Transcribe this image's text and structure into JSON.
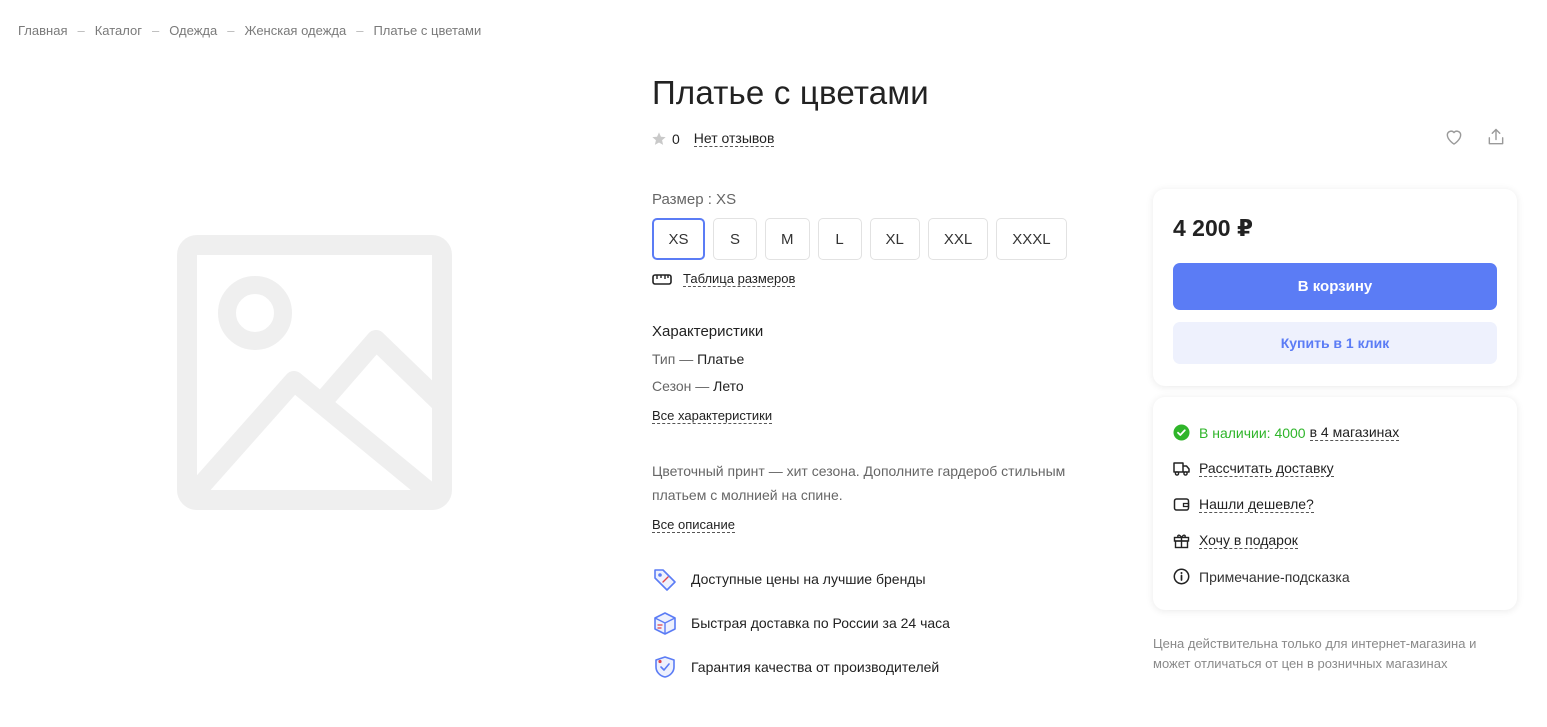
{
  "breadcrumb": {
    "items": [
      "Главная",
      "Каталог",
      "Одежда",
      "Женская одежда",
      "Платье с цветами"
    ],
    "separator": "–"
  },
  "product": {
    "title": "Платье с цветами",
    "rating_count": "0",
    "reviews_link": "Нет отзывов"
  },
  "size": {
    "label": "Размер : XS",
    "options": [
      "XS",
      "S",
      "M",
      "L",
      "XL",
      "XXL",
      "XXXL"
    ],
    "selected": "XS",
    "table_link": "Таблица размеров"
  },
  "characteristics": {
    "title": "Характеристики",
    "rows": [
      {
        "key": "Тип — ",
        "value": "Платье"
      },
      {
        "key": "Сезон — ",
        "value": "Лето"
      }
    ],
    "all_link": "Все характеристики"
  },
  "description": {
    "text": "Цветочный принт — хит сезона. Дополните гардероб стильным платьем с молнией на спине.",
    "all_link": "Все описание"
  },
  "features": [
    {
      "icon": "price-tag-icon",
      "text": "Доступные цены на лучшие бренды"
    },
    {
      "icon": "delivery-box-icon",
      "text": "Быстрая доставка по России за 24 часа"
    },
    {
      "icon": "quality-shield-icon",
      "text": "Гарантия качества от производителей"
    }
  ],
  "buy": {
    "price": "4 200 ₽",
    "cart_button": "В корзину",
    "one_click_button": "Купить в 1 клик"
  },
  "availability": {
    "status": "В наличии: 4000",
    "stores_link": "в 4 магазинах",
    "delivery_link": "Рассчитать доставку",
    "cheaper_link": "Нашли дешевле?",
    "gift_link": "Хочу в подарок",
    "hint": "Примечание-подсказка"
  },
  "note": "Цена действительна только для интернет-магазина и может отличаться от цен в розничных магазинах",
  "colors": {
    "accent": "#5b7cf5",
    "accent_light": "#eef1fd",
    "in_stock": "#2fb52a",
    "placeholder": "#efefef"
  }
}
